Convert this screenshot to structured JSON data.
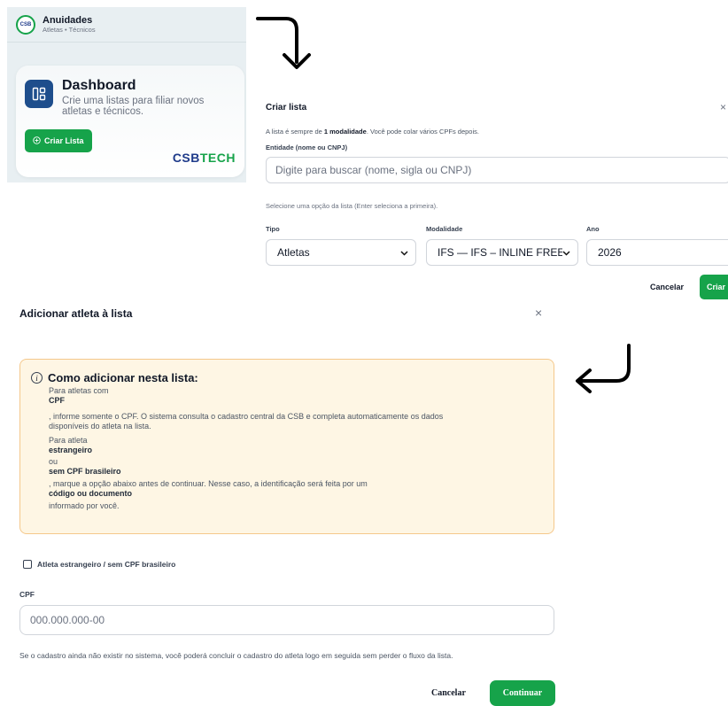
{
  "panel1": {
    "app_title": "Anuidades",
    "app_subtitle": "Atletas • Técnicos",
    "logo_text": "CSB",
    "dashboard_title": "Dashboard",
    "dashboard_desc": "Crie uma listas para filiar novos atletas e técnicos.",
    "create_button": "Criar Lista",
    "brand_csb": "CSB",
    "brand_tech": "TECH"
  },
  "criar_modal": {
    "title": "Criar lista",
    "close": "×",
    "info_prefix": "A lista é sempre de ",
    "info_bold": "1 modalidade",
    "info_suffix": ". Você pode colar vários CPFs depois.",
    "entity_label": "Entidade (nome ou CNPJ)",
    "search_placeholder": "Digite para buscar (nome, sigla ou CNPJ)",
    "hint": "Selecione uma opção da lista (Enter seleciona a primeira).",
    "tipo_label": "Tipo",
    "tipo_value": "Atletas",
    "modalidade_label": "Modalidade",
    "modalidade_value": "IFS — IFS – INLINE FREESTY",
    "ano_label": "Ano",
    "ano_value": "2026",
    "cancel": "Cancelar",
    "create": "Criar"
  },
  "adicionar_modal": {
    "title": "Adicionar atleta à lista",
    "close": "×",
    "box_title": "Como adicionar nesta lista:",
    "lines": {
      "l1": "Para atletas com",
      "l2": "CPF",
      "l3": ", informe somente o CPF. O sistema consulta o cadastro central da CSB e completa automaticamente os dados",
      "l4": "disponíveis do atleta na lista.",
      "l5": "Para atleta",
      "l6": "estrangeiro",
      "l7": "ou",
      "l8": "sem CPF brasileiro",
      "l9": ", marque a opção abaixo antes de continuar. Nesse caso, a identificação será feita por um",
      "l10": "código ou documento",
      "l11": "informado por você."
    },
    "checkbox_label": "Atleta estrangeiro / sem CPF brasileiro",
    "cpf_label": "CPF",
    "cpf_placeholder": "000.000.000-00",
    "note": "Se o cadastro ainda não existir no sistema, você poderá concluir o cadastro do atleta logo em seguida sem perder o fluxo da lista.",
    "cancel": "Cancelar",
    "continue": "Continuar"
  },
  "colors": {
    "accent_green": "#16a34a",
    "brand_blue": "#1e3a8a",
    "notice_bg": "#fef6e4",
    "notice_border": "#f5c88b"
  }
}
